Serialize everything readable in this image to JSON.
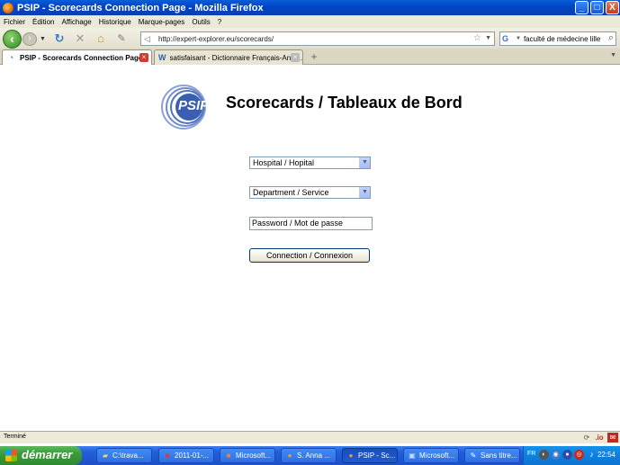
{
  "window": {
    "title": "PSIP - Scorecards Connection Page - Mozilla Firefox",
    "buttons": {
      "minimize": "_",
      "maximize": "□",
      "close": "X"
    }
  },
  "menu": [
    "Fichier",
    "Édition",
    "Affichage",
    "Historique",
    "Marque-pages",
    "Outils",
    "?"
  ],
  "nav": {
    "url": "http://expert-explorer.eu/scorecards/",
    "search_value": "faculté de médecine lille",
    "search_engine_icon": "G"
  },
  "tabs": [
    {
      "label": "PSIP - Scorecards Connection Page",
      "active": true
    },
    {
      "label": "satisfaisant - Dictionnaire Français-Angl...",
      "active": false
    }
  ],
  "page": {
    "logo_text": "PSIP",
    "title": "Scorecards / Tableaux de Bord",
    "hospital_select": "Hospital / Hopital",
    "department_select": "Department / Service",
    "password_placeholder": "Password / Mot de passe",
    "connect_label": "Connection / Connexion"
  },
  "status": {
    "text": "Terminé"
  },
  "taskbar": {
    "start_label": "démarrer",
    "buttons": [
      {
        "label": "C:\\trava...",
        "icon": "folder-icon"
      },
      {
        "label": "2011-01-...",
        "icon": "pdf-icon"
      },
      {
        "label": "Microsoft...",
        "icon": "ppt-icon"
      },
      {
        "label": "S. Anna ...",
        "icon": "firefox-icon"
      },
      {
        "label": "PSIP - Sc...",
        "icon": "firefox-icon",
        "active": true
      },
      {
        "label": "Microsoft...",
        "icon": "app-icon"
      },
      {
        "label": "Sans titre...",
        "icon": "paint-icon"
      }
    ],
    "language": "FR",
    "clock": "22:54"
  },
  "colors": {
    "titlebar": "#0a50d0",
    "taskbar": "#245edb",
    "start_button": "#3b9a3b",
    "logo_blue": "#3a5fb0"
  }
}
